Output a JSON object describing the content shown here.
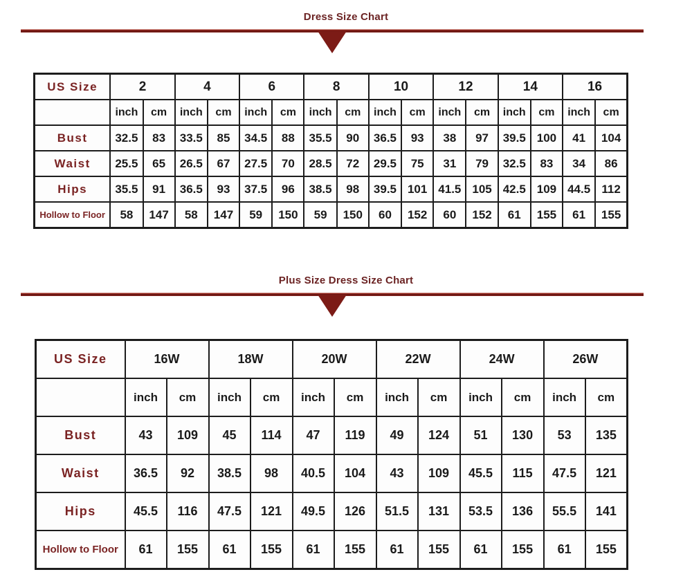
{
  "page": {
    "title_color": "#6b2323",
    "divider_color": "#7c1b16",
    "label_color": "#7a2323",
    "border_color": "#1c1c1c",
    "background": "#ffffff"
  },
  "standard_chart": {
    "title": "Dress Size Chart",
    "size_label": "US Size",
    "sizes": [
      "2",
      "4",
      "6",
      "8",
      "10",
      "12",
      "14",
      "16"
    ],
    "units": [
      "inch",
      "cm"
    ],
    "rows": [
      {
        "label": "Bust",
        "values": [
          "32.5",
          "83",
          "33.5",
          "85",
          "34.5",
          "88",
          "35.5",
          "90",
          "36.5",
          "93",
          "38",
          "97",
          "39.5",
          "100",
          "41",
          "104"
        ]
      },
      {
        "label": "Waist",
        "values": [
          "25.5",
          "65",
          "26.5",
          "67",
          "27.5",
          "70",
          "28.5",
          "72",
          "29.5",
          "75",
          "31",
          "79",
          "32.5",
          "83",
          "34",
          "86"
        ]
      },
      {
        "label": "Hips",
        "values": [
          "35.5",
          "91",
          "36.5",
          "93",
          "37.5",
          "96",
          "38.5",
          "98",
          "39.5",
          "101",
          "41.5",
          "105",
          "42.5",
          "109",
          "44.5",
          "112"
        ]
      },
      {
        "label": "Hollow to Floor",
        "values": [
          "58",
          "147",
          "58",
          "147",
          "59",
          "150",
          "59",
          "150",
          "60",
          "152",
          "60",
          "152",
          "61",
          "155",
          "61",
          "155"
        ]
      }
    ]
  },
  "plus_chart": {
    "title": "Plus Size Dress Size Chart",
    "size_label": "US Size",
    "sizes": [
      "16W",
      "18W",
      "20W",
      "22W",
      "24W",
      "26W"
    ],
    "units": [
      "inch",
      "cm"
    ],
    "rows": [
      {
        "label": "Bust",
        "values": [
          "43",
          "109",
          "45",
          "114",
          "47",
          "119",
          "49",
          "124",
          "51",
          "130",
          "53",
          "135"
        ]
      },
      {
        "label": "Waist",
        "values": [
          "36.5",
          "92",
          "38.5",
          "98",
          "40.5",
          "104",
          "43",
          "109",
          "45.5",
          "115",
          "47.5",
          "121"
        ]
      },
      {
        "label": "Hips",
        "values": [
          "45.5",
          "116",
          "47.5",
          "121",
          "49.5",
          "126",
          "51.5",
          "131",
          "53.5",
          "136",
          "55.5",
          "141"
        ]
      },
      {
        "label": "Hollow to Floor",
        "values": [
          "61",
          "155",
          "61",
          "155",
          "61",
          "155",
          "61",
          "155",
          "61",
          "155",
          "61",
          "155"
        ]
      }
    ]
  }
}
